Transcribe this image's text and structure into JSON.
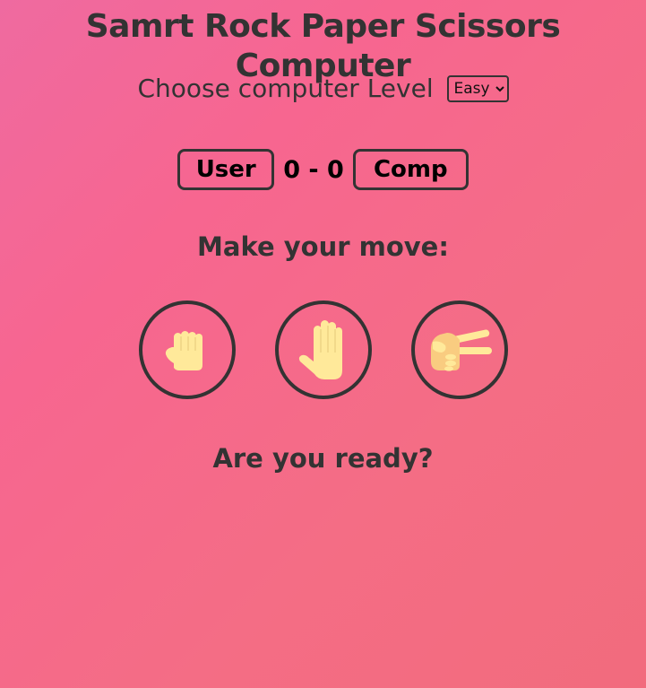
{
  "title": "Samrt Rock Paper Scissors Computer",
  "level": {
    "label": "Choose computer Level",
    "selected": "Easy"
  },
  "score": {
    "user_label": "User",
    "comp_label": "Comp",
    "text": "0 - 0"
  },
  "prompt": "Make your move:",
  "choices": [
    {
      "name": "rock",
      "icon": "raised-fist-icon"
    },
    {
      "name": "paper",
      "icon": "raised-hand-icon"
    },
    {
      "name": "scissors",
      "icon": "victory-hand-icon"
    }
  ],
  "status": "Are you ready?",
  "colors": {
    "background_start": "#ef6aa0",
    "background_end": "#f26b7d",
    "text": "#333333",
    "hand_fill": "#ffe99a",
    "hand_skin": "#f9cc80"
  }
}
